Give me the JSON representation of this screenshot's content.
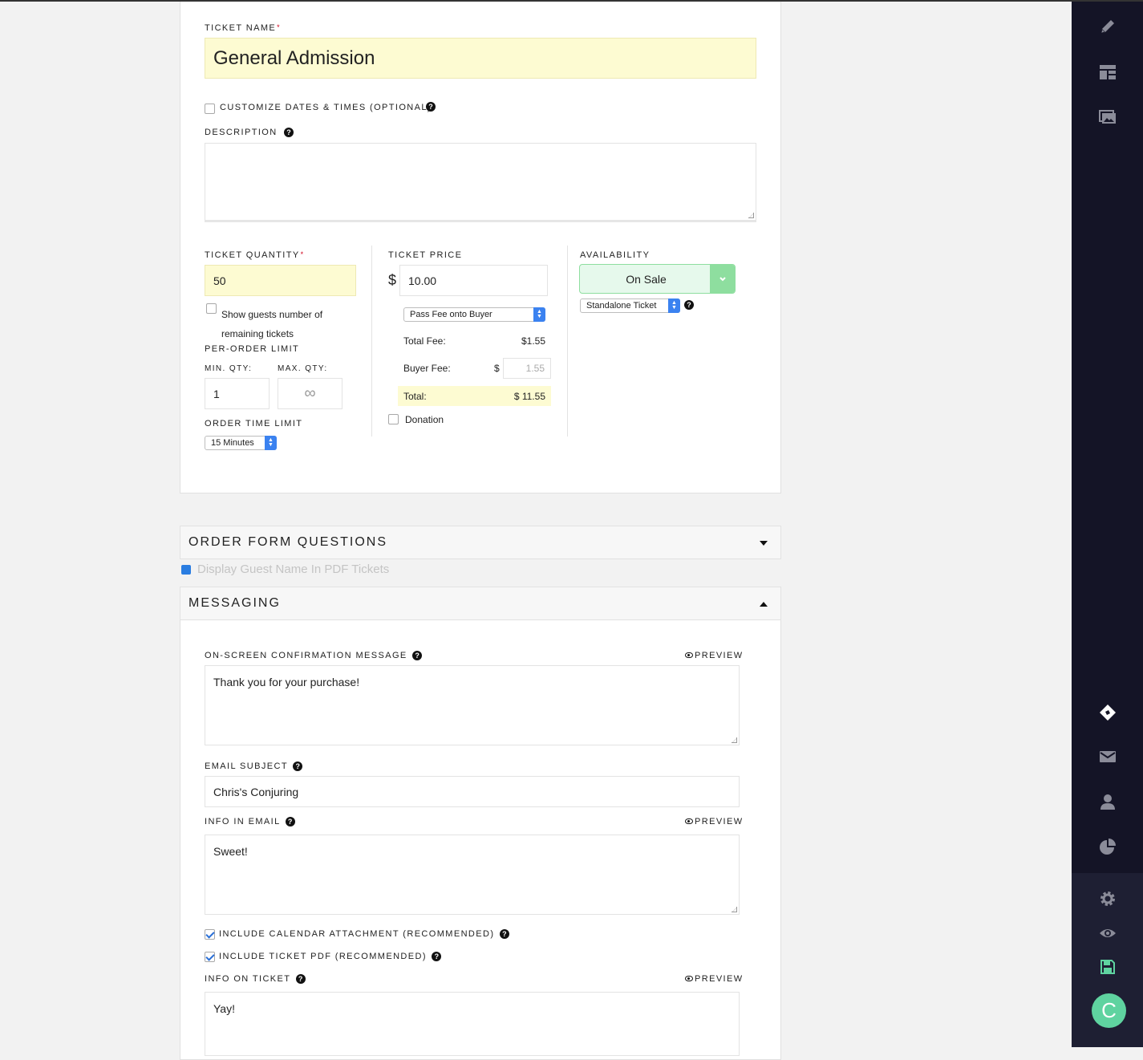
{
  "ticket": {
    "name_label": "TICKET NAME",
    "required_mark": "*",
    "name_value": "General Admission",
    "customize_label": "CUSTOMIZE DATES & TIMES (OPTIONAL)",
    "description_label": "DESCRIPTION",
    "description_value": "",
    "quantity_label": "TICKET QUANTITY",
    "quantity_value": "50",
    "show_remaining_line1": "Show guests number of",
    "show_remaining_line2": "remaining tickets",
    "per_order_label": "PER-ORDER LIMIT",
    "min_label": "MIN. QTY:",
    "min_value": "1",
    "max_label": "MAX. QTY:",
    "max_value": "∞",
    "order_time_label": "ORDER TIME LIMIT",
    "order_time_value": "15 Minutes",
    "price_label": "TICKET PRICE",
    "currency": "$",
    "price_value": "10.00",
    "fee_mode": "Pass Fee onto Buyer",
    "total_fee_label": "Total Fee:",
    "total_fee_value": "$1.55",
    "buyer_fee_label": "Buyer Fee:",
    "buyer_fee_currency": "$",
    "buyer_fee_value": "1.55",
    "total_label": "Total:",
    "total_value": "$ 11.55",
    "donation_label": "Donation",
    "availability_label": "AVAILABILITY",
    "availability_value": "On Sale",
    "ticket_type": "Standalone Ticket",
    "help_glyph": "?",
    "arrow_up": "▲",
    "arrow_down": "▼"
  },
  "order_form": {
    "title": "ORDER FORM QUESTIONS",
    "guest_name_label": "Display Guest Name In PDF Tickets"
  },
  "messaging": {
    "title": "MESSAGING",
    "preview_label": "PREVIEW",
    "confirmation_label": "ON-SCREEN CONFIRMATION MESSAGE",
    "confirmation_value": "Thank you for your purchase!",
    "email_subject_label": "EMAIL SUBJECT",
    "email_subject_value": "Chris's Conjuring",
    "info_email_label": "INFO IN EMAIL",
    "info_email_value": "Sweet!",
    "calendar_label": "INCLUDE CALENDAR ATTACHMENT (RECOMMENDED)",
    "ticket_pdf_label": "INCLUDE TICKET PDF (RECOMMENDED)",
    "info_ticket_label": "INFO ON TICKET",
    "info_ticket_value": "Yay!"
  },
  "sidebar": {
    "avatar_letter": "C",
    "icons": [
      "pencil-icon",
      "layout-icon",
      "images-icon",
      "ticket-icon",
      "mail-icon",
      "user-icon",
      "pie-chart-icon",
      "gear-icon",
      "eye-icon",
      "save-icon"
    ],
    "accent": "#5fd3a0",
    "bg": "#141426"
  },
  "colors": {
    "highlight_yellow": "#fdfbd2",
    "on_sale_green": "#e6f9ec",
    "on_sale_arrow": "#8ede9f",
    "select_blue": "#3b82f0"
  }
}
